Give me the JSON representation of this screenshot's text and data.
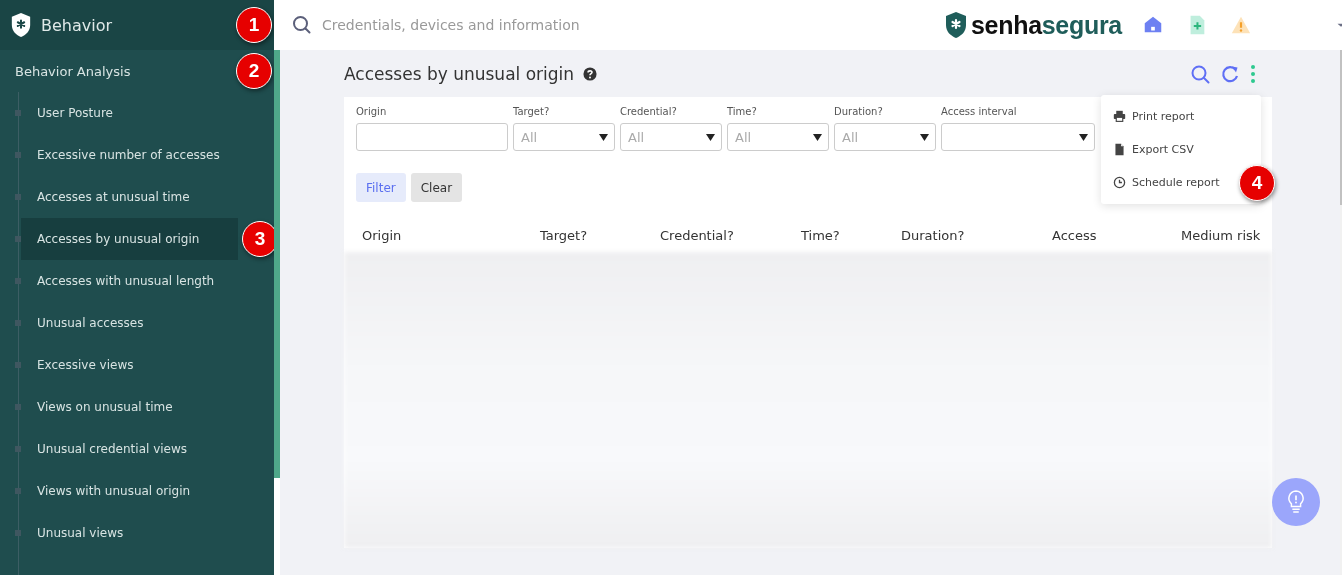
{
  "sidebar": {
    "title": "Behavior",
    "title_callout": "1",
    "section": {
      "label": "Behavior Analysis",
      "callout": "2"
    },
    "items": [
      {
        "label": "User Posture",
        "selected": false
      },
      {
        "label": "Excessive number of accesses",
        "selected": false
      },
      {
        "label": "Accesses at unusual time",
        "selected": false
      },
      {
        "label": "Accesses by unusual origin",
        "selected": true,
        "callout": "3"
      },
      {
        "label": "Accesses with unusual length",
        "selected": false
      },
      {
        "label": "Unusual accesses",
        "selected": false
      },
      {
        "label": "Excessive views",
        "selected": false
      },
      {
        "label": "Views on unusual time",
        "selected": false
      },
      {
        "label": "Unusual credential views",
        "selected": false
      },
      {
        "label": "Views with unusual origin",
        "selected": false
      },
      {
        "label": "Unusual views",
        "selected": false
      }
    ]
  },
  "topbar": {
    "search": {
      "placeholder": "Credentials, devices and information"
    },
    "logo": [
      "senha",
      "segura"
    ],
    "icons": [
      {
        "kind": "home"
      },
      {
        "kind": "file-plus"
      },
      {
        "kind": "warning"
      },
      {
        "kind": "caret"
      }
    ]
  },
  "page": {
    "title": "Accesses by unusual origin",
    "tools": [
      {
        "kind": "search"
      },
      {
        "kind": "refresh"
      },
      {
        "kind": "more"
      }
    ],
    "menu": [
      {
        "label": "Print report",
        "kind": "print"
      },
      {
        "label": "Export CSV",
        "kind": "file"
      },
      {
        "label": "Schedule report",
        "kind": "clock",
        "callout": "4"
      }
    ],
    "filters": [
      {
        "label": "Origin",
        "kind": "text"
      },
      {
        "label": "Target?",
        "kind": "select",
        "value": "All"
      },
      {
        "label": "Credential?",
        "kind": "select",
        "value": "All"
      },
      {
        "label": "Time?",
        "kind": "select",
        "value": "All"
      },
      {
        "label": "Duration?",
        "kind": "select",
        "value": "All"
      },
      {
        "label": "Access interval",
        "kind": "select"
      }
    ],
    "buttons": [
      {
        "label": "Filter",
        "kind": "primary"
      },
      {
        "label": "Clear",
        "kind": "secondary"
      }
    ],
    "table": {
      "columns": [
        "Origin",
        "Target?",
        "Credential?",
        "Time?",
        "Duration?",
        "Access",
        "Medium risk"
      ]
    }
  }
}
